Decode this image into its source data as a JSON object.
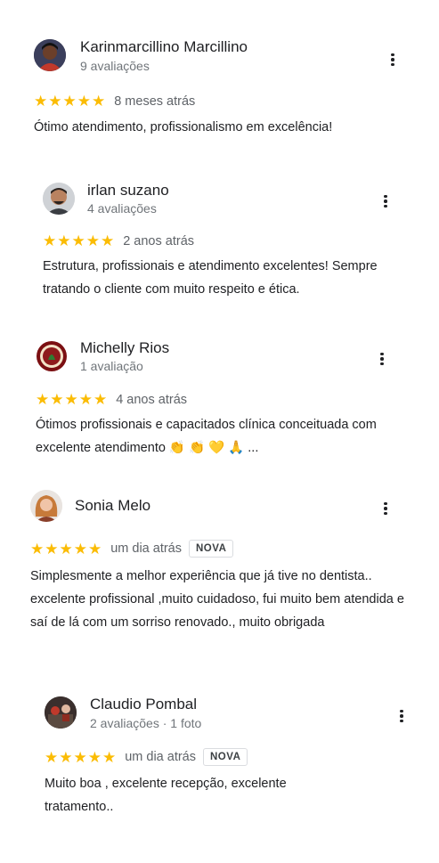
{
  "reviews": [
    {
      "name": "Karinmarcillino Marcillino",
      "meta": "9 avaliações",
      "stars": "★★★★★",
      "when": "8 meses atrás",
      "badge": "",
      "text": "Ótimo atendimento, profissionalismo em excelência!"
    },
    {
      "name": "irlan suzano",
      "meta": "4 avaliações",
      "stars": "★★★★★",
      "when": "2 anos atrás",
      "badge": "",
      "text": "Estrutura, profissionais e atendimento excelentes! Sempre tratando o cliente com muito respeito e ética."
    },
    {
      "name": "Michelly Rios",
      "meta": "1 avaliação",
      "stars": "★★★★★",
      "when": "4 anos atrás",
      "badge": "",
      "text": "Ótimos profissionais e capacitados clínica conceituada com excelente atendimento 👏 👏 💛 🙏 ..."
    },
    {
      "name": "Sonia Melo",
      "meta": "",
      "stars": "★★★★★",
      "when": "um dia atrás",
      "badge": "NOVA",
      "text": "Simplesmente a melhor experiência que já tive no dentista.. excelente profissional ,muito cuidadoso, fui muito bem atendida e saí de lá com um sorriso renovado., muito obrigada"
    },
    {
      "name": "Claudio Pombal",
      "meta": "2 avaliações · 1 foto",
      "stars": "★★★★★",
      "when": "um dia atrás",
      "badge": "NOVA",
      "text": "Muito boa , excelente recepção, excelente tratamento.."
    }
  ],
  "star_color": "#fbbc04",
  "rating_value": 5,
  "rating_max": 5
}
